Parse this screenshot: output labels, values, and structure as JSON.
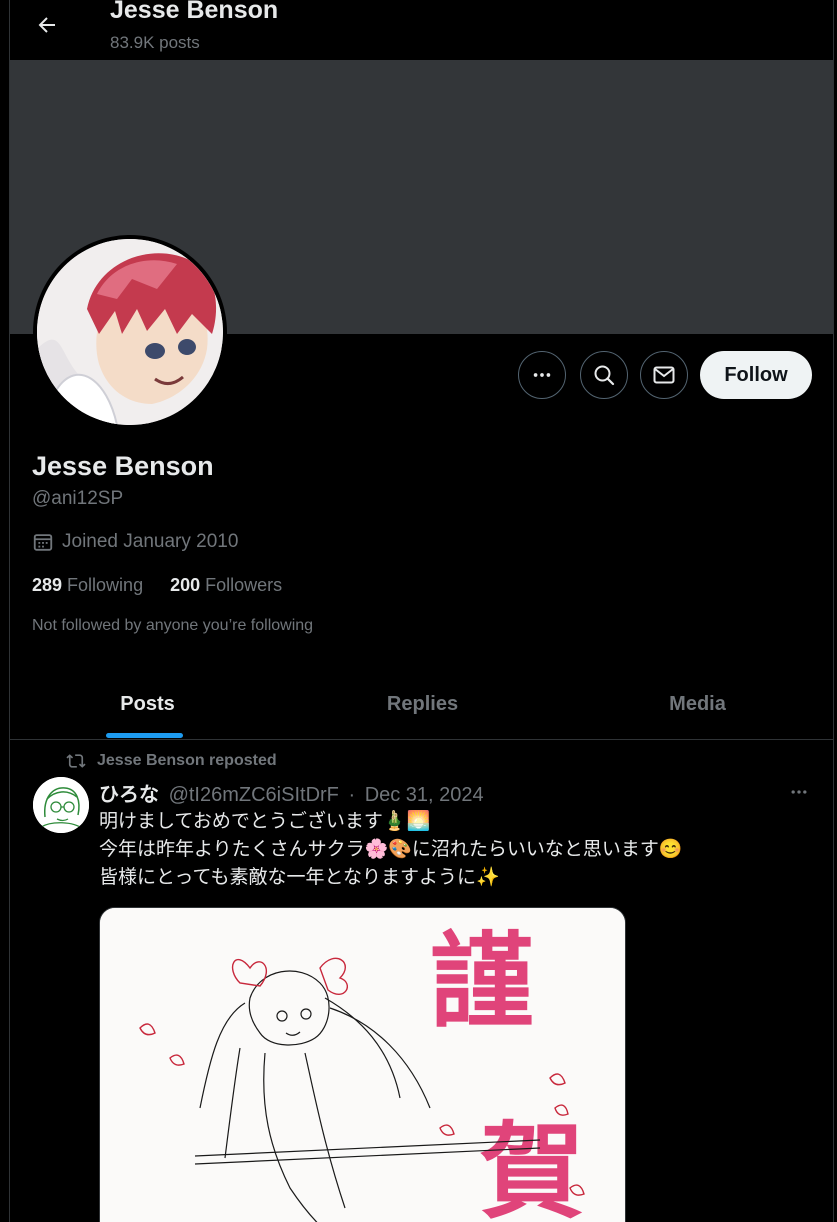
{
  "header": {
    "name": "Jesse Benson",
    "post_count": "83.9K posts"
  },
  "profile": {
    "name": "Jesse Benson",
    "handle": "@ani12SP",
    "joined": "Joined January 2010",
    "following_count": "289",
    "following_label": "Following",
    "followers_count": "200",
    "followers_label": "Followers",
    "not_followed_note": "Not followed by anyone you’re following",
    "follow_label": "Follow"
  },
  "tabs": [
    {
      "label": "Posts",
      "active": true
    },
    {
      "label": "Replies",
      "active": false
    },
    {
      "label": "Media",
      "active": false
    }
  ],
  "post": {
    "repost_label": "Jesse Benson reposted",
    "author": "ひろな",
    "handle": "@tI26mZC6iSItDrF",
    "separator": "·",
    "date": "Dec 31, 2024",
    "lines": [
      "明けましておめでとうございます🎍🌅",
      "今年は昨年よりたくさんサクラ🌸🎨に沼れたらいいなと思います😊",
      "皆様にとっても素敵な一年となりますように✨"
    ],
    "image_text": [
      "謹",
      "賀"
    ]
  },
  "colors": {
    "background": "#000000",
    "banner": "#333639",
    "accent": "#1d9bf0",
    "muted": "#71767b",
    "text": "#e7e9ea",
    "greeting_pink": "#e0447a"
  },
  "icons": {
    "back": "arrow-left-icon",
    "more": "more-horizontal-icon",
    "search": "search-icon",
    "message": "envelope-icon",
    "calendar": "calendar-icon",
    "repost": "repost-icon"
  }
}
